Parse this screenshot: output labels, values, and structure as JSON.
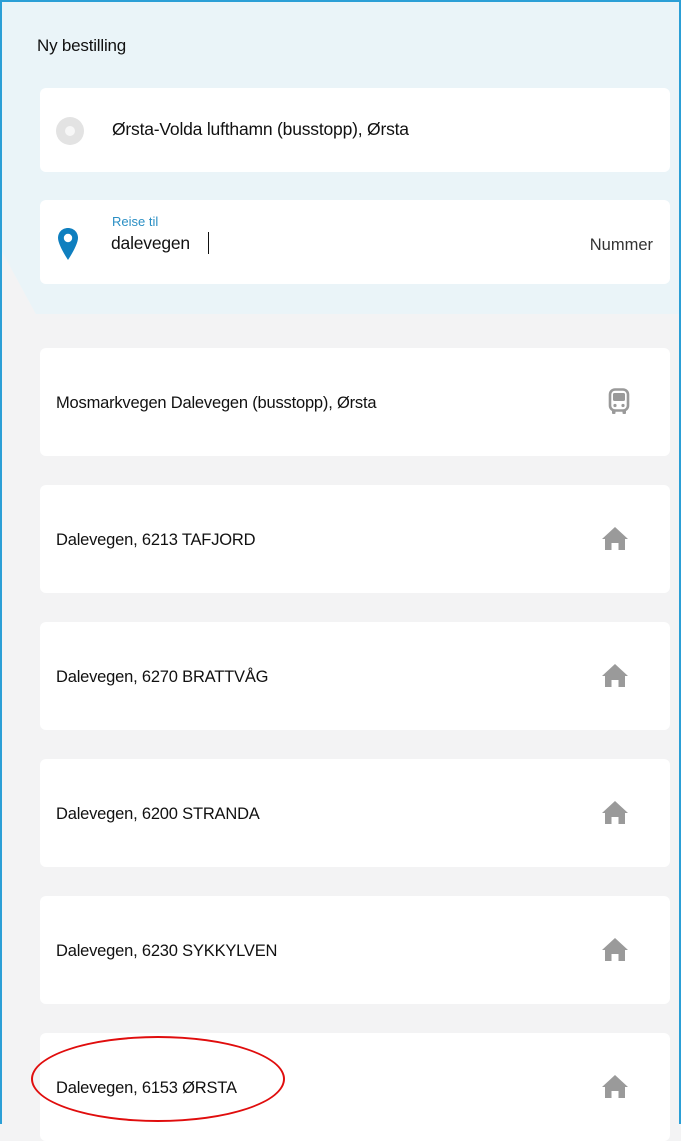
{
  "page": {
    "title": "Ny bestilling"
  },
  "from": {
    "value": "Ørsta-Volda lufthamn (busstopp), Ørsta",
    "icon": "origin-circle-icon"
  },
  "to": {
    "label": "Reise til",
    "value": "dalevegen",
    "number_label": "Nummer",
    "icon": "map-pin-icon"
  },
  "results": [
    {
      "label": "Mosmarkvegen Dalevegen (busstopp), Ørsta",
      "icon": "bus-icon"
    },
    {
      "label": "Dalevegen, 6213 TAFJORD",
      "icon": "home-icon"
    },
    {
      "label": "Dalevegen, 6270 BRATTVÅG",
      "icon": "home-icon"
    },
    {
      "label": "Dalevegen, 6200 STRANDA",
      "icon": "home-icon"
    },
    {
      "label": "Dalevegen, 6230 SYKKYLVEN",
      "icon": "home-icon"
    },
    {
      "label": "Dalevegen, 6153 ØRSTA",
      "icon": "home-icon"
    }
  ],
  "colors": {
    "accent": "#2b9fd6",
    "pin": "#0f7fbf",
    "header_bg": "#eaf4f8",
    "page_bg": "#f3f3f4",
    "icon_grey": "#9a9a9a",
    "highlight": "#e00d0d"
  }
}
